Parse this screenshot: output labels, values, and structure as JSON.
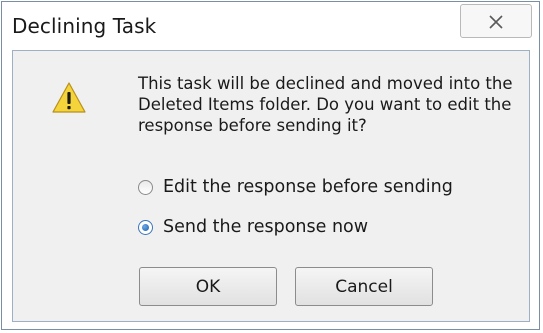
{
  "window": {
    "title": "Declining Task"
  },
  "icons": {
    "close": "close-icon",
    "warning": "warning-icon"
  },
  "message": "This task will be declined and moved into the Deleted Items folder. Do you want to edit the response before sending it?",
  "options": [
    {
      "label": "Edit the response before sending",
      "checked": false
    },
    {
      "label": "Send the response now",
      "checked": true
    }
  ],
  "buttons": {
    "ok": "OK",
    "cancel": "Cancel"
  },
  "colors": {
    "accent": "#3b74b8",
    "warning_fill": "#f4d33b",
    "client_bg": "#f0f0f0"
  }
}
